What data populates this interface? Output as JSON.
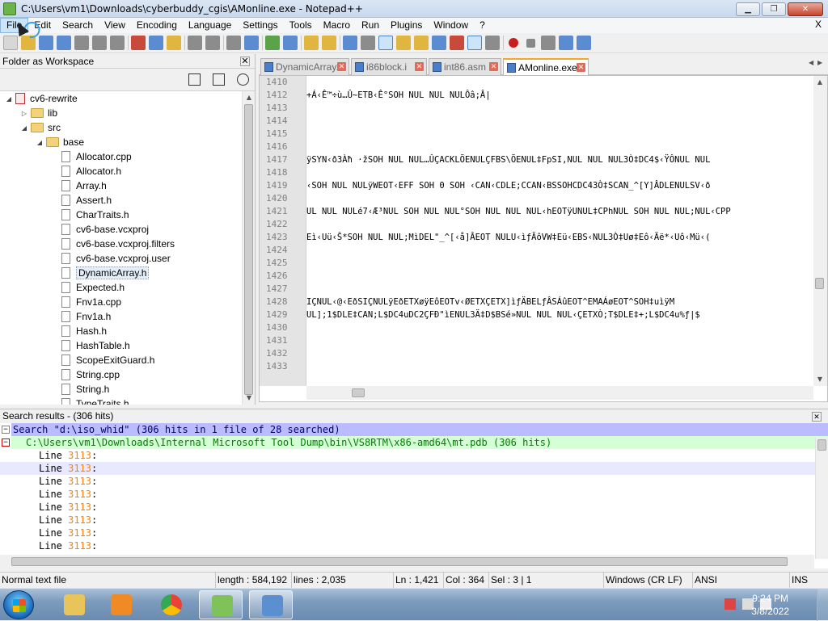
{
  "window": {
    "title": "C:\\Users\\vm1\\Downloads\\cyberbuddy_cgis\\AMonline.exe - Notepad++",
    "min": "▁",
    "max": "❐",
    "close": "✕"
  },
  "menu": {
    "items": [
      "File",
      "Edit",
      "Search",
      "View",
      "Encoding",
      "Language",
      "Settings",
      "Tools",
      "Macro",
      "Run",
      "Plugins",
      "Window",
      "?"
    ],
    "close_doc": "X"
  },
  "workspace": {
    "title": "Folder as Workspace",
    "close": "✕",
    "tree": [
      {
        "label": "cv6-rewrite",
        "type": "project",
        "depth": 0,
        "twisty": "◢"
      },
      {
        "label": "lib",
        "type": "folder",
        "depth": 1,
        "twisty": "▷"
      },
      {
        "label": "src",
        "type": "folder",
        "depth": 1,
        "twisty": "◢"
      },
      {
        "label": "base",
        "type": "folder",
        "depth": 2,
        "twisty": "◢"
      },
      {
        "label": "Allocator.cpp",
        "type": "file",
        "depth": 3
      },
      {
        "label": "Allocator.h",
        "type": "file",
        "depth": 3
      },
      {
        "label": "Array.h",
        "type": "file",
        "depth": 3
      },
      {
        "label": "Assert.h",
        "type": "file",
        "depth": 3
      },
      {
        "label": "CharTraits.h",
        "type": "file",
        "depth": 3
      },
      {
        "label": "cv6-base.vcxproj",
        "type": "file",
        "depth": 3
      },
      {
        "label": "cv6-base.vcxproj.filters",
        "type": "file",
        "depth": 3
      },
      {
        "label": "cv6-base.vcxproj.user",
        "type": "file",
        "depth": 3
      },
      {
        "label": "DynamicArray.h",
        "type": "file",
        "depth": 3,
        "selected": true
      },
      {
        "label": "Expected.h",
        "type": "file",
        "depth": 3
      },
      {
        "label": "Fnv1a.cpp",
        "type": "file",
        "depth": 3
      },
      {
        "label": "Fnv1a.h",
        "type": "file",
        "depth": 3
      },
      {
        "label": "Hash.h",
        "type": "file",
        "depth": 3
      },
      {
        "label": "HashTable.h",
        "type": "file",
        "depth": 3
      },
      {
        "label": "ScopeExitGuard.h",
        "type": "file",
        "depth": 3
      },
      {
        "label": "String.cpp",
        "type": "file",
        "depth": 3
      },
      {
        "label": "String.h",
        "type": "file",
        "depth": 3
      },
      {
        "label": "TypeTraits.h",
        "type": "file",
        "depth": 3
      }
    ]
  },
  "tabs": [
    {
      "label": "DynamicArray.h",
      "active": false
    },
    {
      "label": "i86block.i",
      "active": false
    },
    {
      "label": "int86.asm",
      "active": false
    },
    {
      "label": "AMonline.exe",
      "active": true
    }
  ],
  "editor": {
    "lines": [
      {
        "n": "1410",
        "t": ""
      },
      {
        "n": "1412",
        "t": "+Á‹Ê™÷ù…Û~ETB‹Ê°SOH NUL NUL NULÔâ;Â|"
      },
      {
        "n": "1413",
        "t": ""
      },
      {
        "n": "1414",
        "t": ""
      },
      {
        "n": "1415",
        "t": ""
      },
      {
        "n": "1416",
        "t": ""
      },
      {
        "n": "1417",
        "t": "ÿSYN‹ð3Àħ ·žSOH NUL NUL…ÛÇACKLÕENULÇFBS\\ÕENUL‡FpSI,NUL NUL NUL3Ò‡DC4$‹ŸÔNUL NUL"
      },
      {
        "n": "1418",
        "t": ""
      },
      {
        "n": "1419",
        "t": "‹SOH NUL NULÿWEOT‹EFF SOH 0 SOH ‹CAN‹CDLE;CCAN‹BSSOHCDC43Ò‡SCAN_^[Y]ÂDLENULSV‹ð"
      },
      {
        "n": "1420",
        "t": ""
      },
      {
        "n": "1421",
        "t": "UL NUL NULé7‹Æ³NUL SOH NUL NUL°SOH NUL NUL NUL‹hEOTÿUNUL‡CPhNUL SOH NUL NUL;NUL‹CPP"
      },
      {
        "n": "1422",
        "t": ""
      },
      {
        "n": "1423",
        "t": "Eì‹Uü‹Š*SOH NUL NUL;MìDEL\"_^[‹å]ÂEOT NULU‹ìƒÄôVW‡Eü‹EBS‹NUL3Ò‡Uø‡Eô‹Äë*‹Uô‹Mü‹("
      },
      {
        "n": "1424",
        "t": ""
      },
      {
        "n": "1425",
        "t": ""
      },
      {
        "n": "1426",
        "t": ""
      },
      {
        "n": "1427",
        "t": ""
      },
      {
        "n": "1428",
        "t": "IÇNUL‹@‹EðSIÇNULÿEðETXøÿEôEOTv‹ØETXÇETX]ìƒÄBELƒÂSÁûEOT^EMAÁøEOT^SOH‡uìÿM"
      },
      {
        "n": "1429",
        "t": "UL];1$DLE‡CAN;L$DC4uDC2ÇFÐ\"ìENUL3Ä‡D$BSé»NUL NUL NUL‹ÇETXÒ;T$DLE‡+;L$DC4u%ƒ|$"
      },
      {
        "n": "1430",
        "t": ""
      },
      {
        "n": "1431",
        "t": ""
      },
      {
        "n": "1432",
        "t": ""
      },
      {
        "n": "1433",
        "t": ""
      }
    ]
  },
  "search": {
    "panel_title": "Search results - (306 hits)",
    "close": "✕",
    "summary": "Search \"d:\\iso_whid\" (306 hits in 1 file of 28 searched)",
    "file_line": "C:\\Users\\vm1\\Downloads\\Internal Microsoft Tool Dump\\bin\\VS8RTM\\x86-amd64\\mt.pdb (306 hits)",
    "results": [
      {
        "prefix": "Line ",
        "num": "3113",
        "suffix": ":"
      },
      {
        "prefix": "Line ",
        "num": "3113",
        "suffix": ":",
        "highlight": true
      },
      {
        "prefix": "Line ",
        "num": "3113",
        "suffix": ":"
      },
      {
        "prefix": "Line ",
        "num": "3113",
        "suffix": ":"
      },
      {
        "prefix": "Line ",
        "num": "3113",
        "suffix": ":"
      },
      {
        "prefix": "Line ",
        "num": "3113",
        "suffix": ":"
      },
      {
        "prefix": "Line ",
        "num": "3113",
        "suffix": ":"
      },
      {
        "prefix": "Line ",
        "num": "3113",
        "suffix": ":"
      }
    ]
  },
  "status": {
    "type": "Normal text file",
    "length": "length : 584,192",
    "lines": "lines : 2,035",
    "ln": "Ln : 1,421",
    "col": "Col : 364",
    "sel": "Sel : 3 | 1",
    "eol": "Windows (CR LF)",
    "enc": "ANSI",
    "ins": "INS"
  },
  "taskbar": {
    "time": "9:24 PM",
    "date": "3/8/2022"
  }
}
